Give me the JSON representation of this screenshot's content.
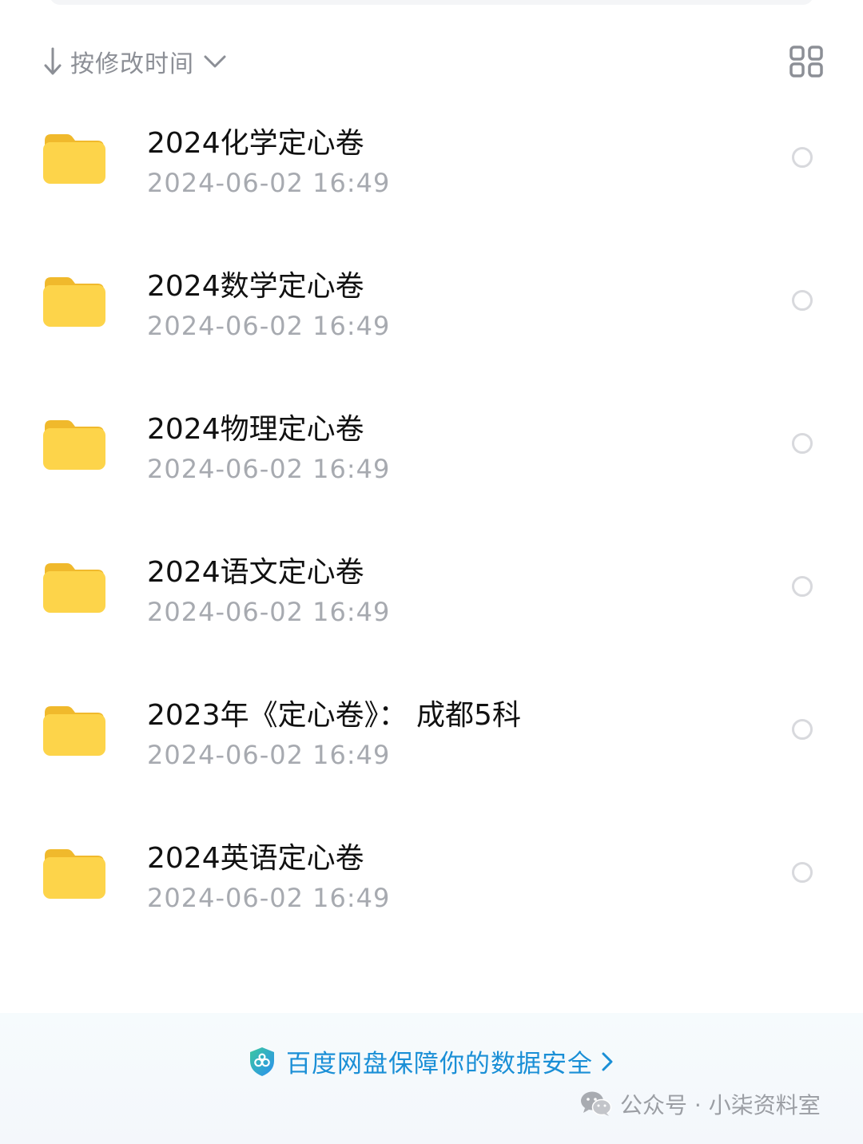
{
  "sort": {
    "label": "按修改时间"
  },
  "files": [
    {
      "name": "2024化学定心卷",
      "modified": "2024-06-02  16:49"
    },
    {
      "name": "2024数学定心卷",
      "modified": "2024-06-02  16:49"
    },
    {
      "name": "2024物理定心卷",
      "modified": "2024-06-02  16:49"
    },
    {
      "name": "2024语文定心卷",
      "modified": "2024-06-02  16:49"
    },
    {
      "name": "2023年《定心卷》： 成都5科",
      "modified": "2024-06-02  16:49"
    },
    {
      "name": "2024英语定心卷",
      "modified": "2024-06-02  16:49"
    }
  ],
  "security": {
    "text": "百度网盘保障你的数据安全"
  },
  "watermark": {
    "text": "公众号 · 小柒资料室"
  },
  "colors": {
    "folder": "#fdd44a",
    "link": "#1a8fd6",
    "secondary_text": "#a7aab0"
  },
  "icons": {
    "sort": "arrow-down-icon",
    "dropdown": "chevron-down-icon",
    "view_toggle": "grid-view-icon",
    "folder": "folder-icon",
    "select": "radio-circle-icon",
    "security": "shield-icon",
    "link": "chevron-right-icon",
    "source": "wechat-icon"
  }
}
